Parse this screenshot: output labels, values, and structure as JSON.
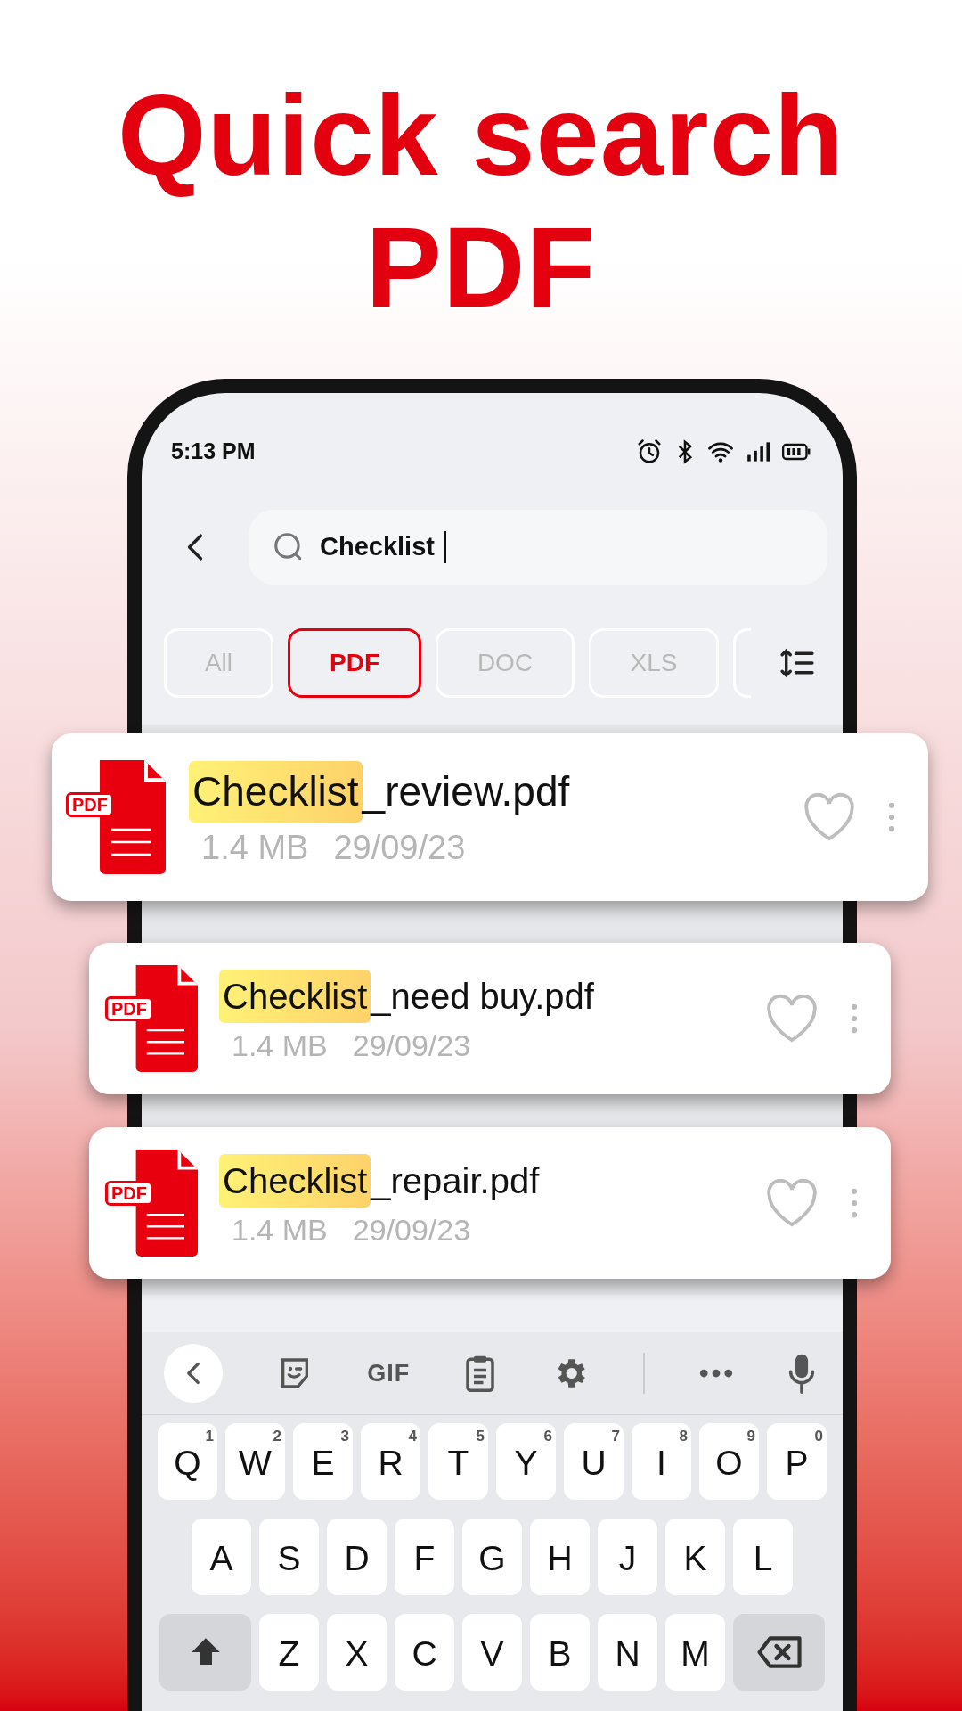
{
  "headline": [
    "Quick search",
    "PDF"
  ],
  "status_bar": {
    "time": "5:13 PM"
  },
  "search": {
    "value": "Checklist ",
    "focused": true
  },
  "filters": [
    {
      "label": "All",
      "selected": false
    },
    {
      "label": "PDF",
      "selected": true
    },
    {
      "label": "DOC",
      "selected": false
    },
    {
      "label": "XLS",
      "selected": false
    }
  ],
  "files": [
    {
      "badge": "PDF",
      "match": "Checklist",
      "rest": "_review.pdf",
      "size": "1.4 MB",
      "date": "29/09/23",
      "favorite": false
    },
    {
      "badge": "PDF",
      "match": "Checklist",
      "rest": "_need buy.pdf",
      "size": "1.4 MB",
      "date": "29/09/23",
      "favorite": false
    },
    {
      "badge": "PDF",
      "match": "Checklist",
      "rest": "_repair.pdf",
      "size": "1.4 MB",
      "date": "29/09/23",
      "favorite": false
    }
  ],
  "keyboard": {
    "toolbar": [
      {
        "kind": "back"
      },
      {
        "kind": "sticker"
      },
      {
        "kind": "gif",
        "label": "GIF"
      },
      {
        "kind": "clipboard"
      },
      {
        "kind": "settings"
      },
      {
        "kind": "divider"
      },
      {
        "kind": "more"
      },
      {
        "kind": "mic"
      }
    ],
    "rows": [
      [
        {
          "kind": "letter",
          "label": "Q",
          "hint": "1"
        },
        {
          "kind": "letter",
          "label": "W",
          "hint": "2"
        },
        {
          "kind": "letter",
          "label": "E",
          "hint": "3"
        },
        {
          "kind": "letter",
          "label": "R",
          "hint": "4"
        },
        {
          "kind": "letter",
          "label": "T",
          "hint": "5"
        },
        {
          "kind": "letter",
          "label": "Y",
          "hint": "6"
        },
        {
          "kind": "letter",
          "label": "U",
          "hint": "7"
        },
        {
          "kind": "letter",
          "label": "I",
          "hint": "8"
        },
        {
          "kind": "letter",
          "label": "O",
          "hint": "9"
        },
        {
          "kind": "letter",
          "label": "P",
          "hint": "0"
        }
      ],
      [
        {
          "kind": "letter",
          "label": "A"
        },
        {
          "kind": "letter",
          "label": "S"
        },
        {
          "kind": "letter",
          "label": "D"
        },
        {
          "kind": "letter",
          "label": "F"
        },
        {
          "kind": "letter",
          "label": "G"
        },
        {
          "kind": "letter",
          "label": "H"
        },
        {
          "kind": "letter",
          "label": "J"
        },
        {
          "kind": "letter",
          "label": "K"
        },
        {
          "kind": "letter",
          "label": "L"
        }
      ],
      [
        {
          "kind": "shift"
        },
        {
          "kind": "letter",
          "label": "Z"
        },
        {
          "kind": "letter",
          "label": "X"
        },
        {
          "kind": "letter",
          "label": "C"
        },
        {
          "kind": "letter",
          "label": "V"
        },
        {
          "kind": "letter",
          "label": "B"
        },
        {
          "kind": "letter",
          "label": "N"
        },
        {
          "kind": "letter",
          "label": "M"
        },
        {
          "kind": "backspace"
        }
      ]
    ]
  }
}
